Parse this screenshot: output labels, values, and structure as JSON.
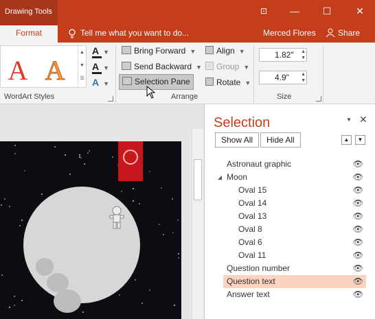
{
  "titlebar": {
    "context_tab": "Drawing Tools",
    "restore_icon": "ribbon-display-icon",
    "minimize": "—",
    "maximize": "☐",
    "close": "✕"
  },
  "tabs": {
    "format": "Format",
    "tell_me": "Tell me what you want to do...",
    "user": "Merced Flores",
    "share": "Share"
  },
  "ribbon": {
    "wordart_group": "WordArt Styles",
    "arrange_group": "Arrange",
    "size_group": "Size",
    "bring_forward": "Bring Forward",
    "send_backward": "Send Backward",
    "selection_pane": "Selection Pane",
    "align": "Align",
    "group": "Group",
    "rotate": "Rotate",
    "height": "1.82\"",
    "width": "4.9\"",
    "sample_letter": "A"
  },
  "panel": {
    "title": "Selection",
    "show_all": "Show All",
    "hide_all": "Hide All",
    "items": [
      {
        "label": "Astronaut graphic",
        "indent": 0
      },
      {
        "label": "Moon",
        "indent": 0,
        "expanded": true
      },
      {
        "label": "Oval 15",
        "indent": 1
      },
      {
        "label": "Oval 14",
        "indent": 1
      },
      {
        "label": "Oval 13",
        "indent": 1
      },
      {
        "label": "Oval 8",
        "indent": 1
      },
      {
        "label": "Oval 6",
        "indent": 1
      },
      {
        "label": "Oval 11",
        "indent": 1
      },
      {
        "label": "Question number",
        "indent": 0
      },
      {
        "label": "Question text",
        "indent": 0,
        "selected": true
      },
      {
        "label": "Answer text",
        "indent": 0
      }
    ]
  },
  "colors": {
    "accent": "#c43e1c",
    "selected_row": "#fcd3be",
    "wordart_red": "#e03b2b",
    "wordart_orange": "#f59a42"
  }
}
